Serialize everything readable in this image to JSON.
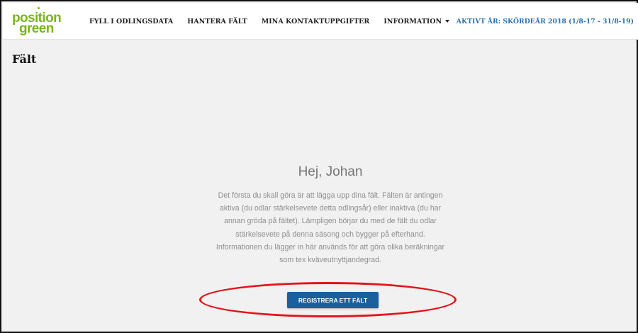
{
  "brand": {
    "logo_line1": "position",
    "logo_line2": "green",
    "color": "#7ab51d"
  },
  "nav": {
    "items": [
      {
        "label": "FYLL I ODLINGSDATA"
      },
      {
        "label": "HANTERA FÄLT"
      },
      {
        "label": "MINA KONTAKTUPPGIFTER"
      },
      {
        "label": "INFORMATION",
        "has_dropdown": true
      }
    ],
    "active_year": "AKTIVT ÅR: SKÖRDEÅR 2018 (1/8-17 - 31/8-19)",
    "active_year_color": "#2c73b0"
  },
  "page": {
    "title": "Fält"
  },
  "welcome": {
    "greeting": "Hej, Johan",
    "lines": [
      "Det första du skall göra är att lägga upp dina fält. Fälten är antingen",
      "aktiva (du odlar stärkelsevete detta odlingsår) eller inaktiva (du har",
      "annan gröda på fältet). Lämpligen börjar du med de fält du odlar",
      "stärkelsevete på denna säsong och bygger på efterhand.",
      "Informationen du lägger in här används för att göra olika beräkningar",
      "som tex kväveutnyttjandegrad."
    ],
    "button_label": "REGISTRERA ETT FÄLT",
    "button_color": "#1c5f9d"
  },
  "annotation": {
    "highlight_color": "#e3141a"
  }
}
